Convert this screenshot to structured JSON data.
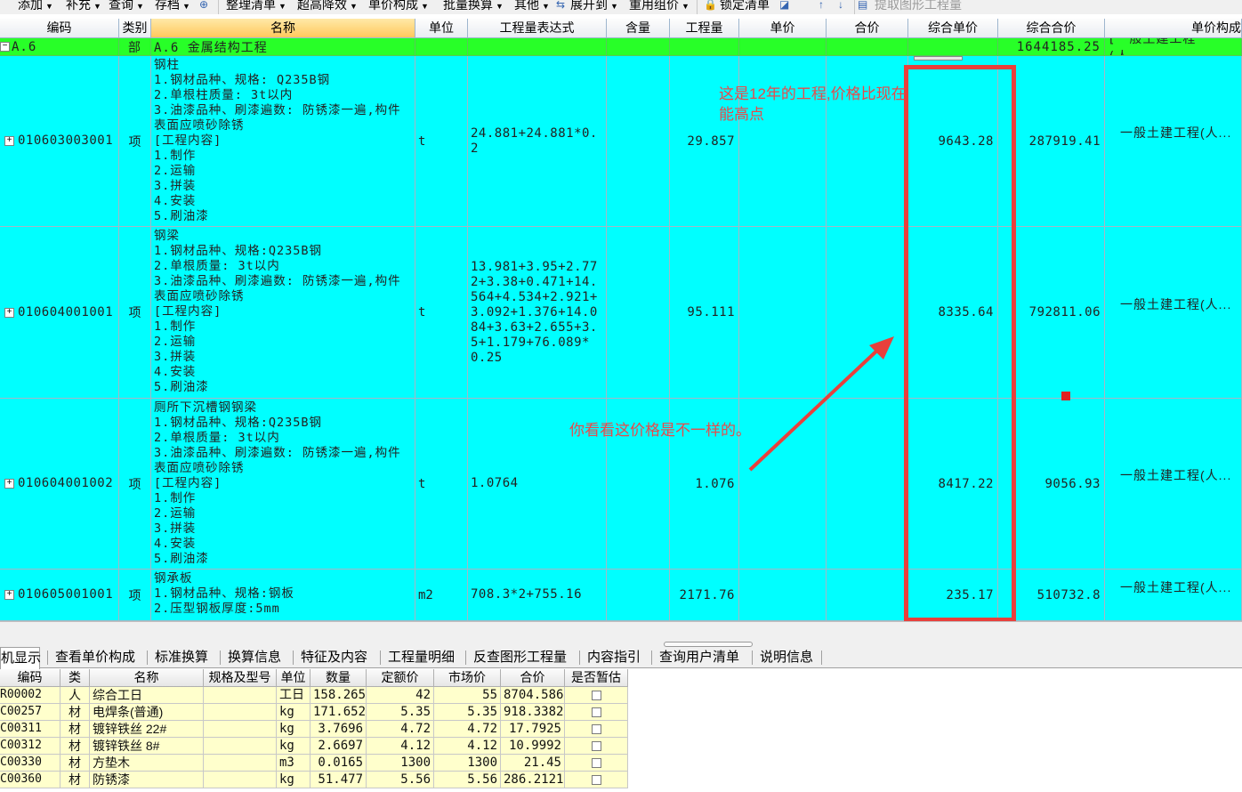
{
  "toolbar": {
    "items": [
      {
        "label": "添加",
        "dropdown": true
      },
      {
        "label": "补充",
        "dropdown": true
      },
      {
        "label": "查询",
        "dropdown": true
      },
      {
        "label": "存档",
        "dropdown": true
      },
      {
        "label": "整理清单",
        "dropdown": true
      },
      {
        "label": "超高降效",
        "dropdown": true
      },
      {
        "label": "单价构成",
        "dropdown": true
      },
      {
        "label": "批量换算",
        "dropdown": true
      },
      {
        "label": "其他",
        "dropdown": true
      },
      {
        "label": "展开到",
        "dropdown": true
      },
      {
        "label": "重用组价",
        "dropdown": true
      },
      {
        "label": "锁定清单",
        "dropdown": false
      },
      {
        "label": "提取图形工程量",
        "dropdown": false
      }
    ]
  },
  "grid": {
    "headers": [
      "编码",
      "类别",
      "名称",
      "单位",
      "工程量表达式",
      "含量",
      "工程量",
      "单价",
      "合价",
      "综合单价",
      "综合合价",
      "单价构成"
    ],
    "section": {
      "code": "A.6",
      "type": "部",
      "name": "A.6  金属结构工程",
      "total": "1644185.25",
      "composition": "[一般土建工程(人..."
    },
    "rows": [
      {
        "code": "010603003001",
        "type": "项",
        "name": "钢柱\n1.钢材品种、规格: Q235B钢\n2.单根柱质量: 3t以内\n3.油漆品种、刷漆遍数: 防锈漆一遍,构件表面应喷砂除锈\n[工程内容]\n1.制作\n2.运输\n3.拼装\n4.安装\n5.刷油漆",
        "unit": "t",
        "expression": "24.881+24.881*0.2",
        "quantity": "29.857",
        "unit_price": "9643.28",
        "total_price": "287919.41",
        "composition": "一般土建工程(人..."
      },
      {
        "code": "010604001001",
        "type": "项",
        "name": "钢梁\n1.钢材品种、规格:Q235B钢\n2.单根质量: 3t以内\n3.油漆品种、刷漆遍数: 防锈漆一遍,构件表面应喷砂除锈\n[工程内容]\n1.制作\n2.运输\n3.拼装\n4.安装\n5.刷油漆",
        "unit": "t",
        "expression": "13.981+3.95+2.772+3.38+0.471+14.564+4.534+2.921+3.092+1.376+14.084+3.63+2.655+3.5+1.179+76.089*0.25",
        "quantity": "95.111",
        "unit_price": "8335.64",
        "total_price": "792811.06",
        "composition": "一般土建工程(人..."
      },
      {
        "code": "010604001002",
        "type": "项",
        "name": "厕所下沉槽钢钢梁\n1.钢材品种、规格:Q235B钢\n2.单根质量: 3t以内\n3.油漆品种、刷漆遍数: 防锈漆一遍,构件表面应喷砂除锈\n[工程内容]\n1.制作\n2.运输\n3.拼装\n4.安装\n5.刷油漆",
        "unit": "t",
        "expression": "1.0764",
        "quantity": "1.076",
        "unit_price": "8417.22",
        "total_price": "9056.93",
        "composition": "一般土建工程(人..."
      },
      {
        "code": "010605001001",
        "type": "项",
        "name": "钢承板\n1.钢材品种、规格:钢板\n2.压型钢板厚度:5mm",
        "unit": "m2",
        "expression": "708.3*2+755.16",
        "quantity": "2171.76",
        "unit_price": "235.17",
        "total_price": "510732.8",
        "composition": "一般土建工程(人..."
      }
    ]
  },
  "annotations": {
    "note_1": "这是12年的工程,价格比现在能高点",
    "note_2": "你看看这价格是不一样的。",
    "color": "#e8403c"
  },
  "tabs": [
    "机显示",
    "查看单价构成",
    "标准换算",
    "换算信息",
    "特征及内容",
    "工程量明细",
    "反查图形工程量",
    "内容指引",
    "查询用户清单",
    "说明信息"
  ],
  "materials": {
    "headers": [
      "编码",
      "类",
      "名称",
      "规格及型号",
      "单位",
      "数量",
      "定额价",
      "市场价",
      "合价",
      "是否暂估"
    ],
    "rows": [
      {
        "code": "R00002",
        "type": "人",
        "name": "综合工日",
        "spec": "",
        "unit": "工日",
        "qty": "158.265",
        "quota_price": "42",
        "market_price": "55",
        "total": "8704.586",
        "provisional": false
      },
      {
        "code": "C00257",
        "type": "材",
        "name": "电焊条(普通)",
        "spec": "",
        "unit": "kg",
        "qty": "171.652",
        "quota_price": "5.35",
        "market_price": "5.35",
        "total": "918.3382",
        "provisional": false
      },
      {
        "code": "C00311",
        "type": "材",
        "name": "镀锌铁丝 22#",
        "spec": "",
        "unit": "kg",
        "qty": "3.7696",
        "quota_price": "4.72",
        "market_price": "4.72",
        "total": "17.7925",
        "provisional": false
      },
      {
        "code": "C00312",
        "type": "材",
        "name": "镀锌铁丝 8#",
        "spec": "",
        "unit": "kg",
        "qty": "2.6697",
        "quota_price": "4.12",
        "market_price": "4.12",
        "total": "10.9992",
        "provisional": false
      },
      {
        "code": "C00330",
        "type": "材",
        "name": "方垫木",
        "spec": "",
        "unit": "m3",
        "qty": "0.0165",
        "quota_price": "1300",
        "market_price": "1300",
        "total": "21.45",
        "provisional": false
      },
      {
        "code": "C00360",
        "type": "材",
        "name": "防锈漆",
        "spec": "",
        "unit": "kg",
        "qty": "51.477",
        "quota_price": "5.56",
        "market_price": "5.56",
        "total": "286.2121",
        "provisional": false
      }
    ]
  }
}
